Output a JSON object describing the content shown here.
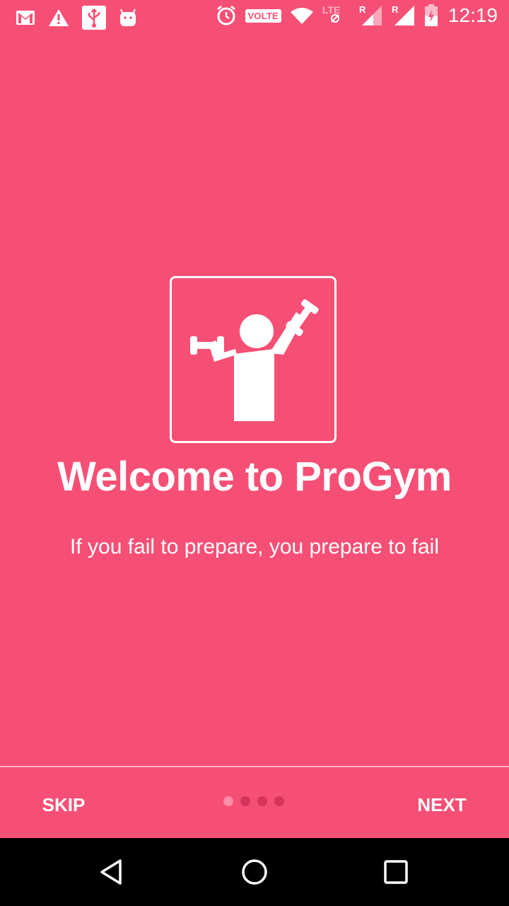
{
  "status_bar": {
    "time": "12:19",
    "volte_label": "VOLTE",
    "network_label": "LTE",
    "roaming_label_1": "R",
    "roaming_label_2": "R",
    "icons": [
      "gmail-icon",
      "warning-icon",
      "usb-icon",
      "android-icon",
      "alarm-icon",
      "volte-icon",
      "wifi-icon",
      "lte-icon",
      "signal-icon",
      "signal-icon",
      "battery-icon"
    ]
  },
  "onboarding": {
    "logo_icon": "weightlifter-icon",
    "title": "Welcome to ProGym",
    "subtitle": "If you fail to prepare, you prepare to fail",
    "page_index": 1,
    "page_count": 4
  },
  "bottom_bar": {
    "skip_label": "SKIP",
    "next_label": "NEXT"
  },
  "nav_bar": {
    "icons": [
      "back-icon",
      "home-icon",
      "recents-icon"
    ]
  },
  "colors": {
    "background": "#F64F75",
    "dot_active": "#FF8DA8",
    "dot_inactive": "#D4345A",
    "nav_bar": "#000000"
  }
}
